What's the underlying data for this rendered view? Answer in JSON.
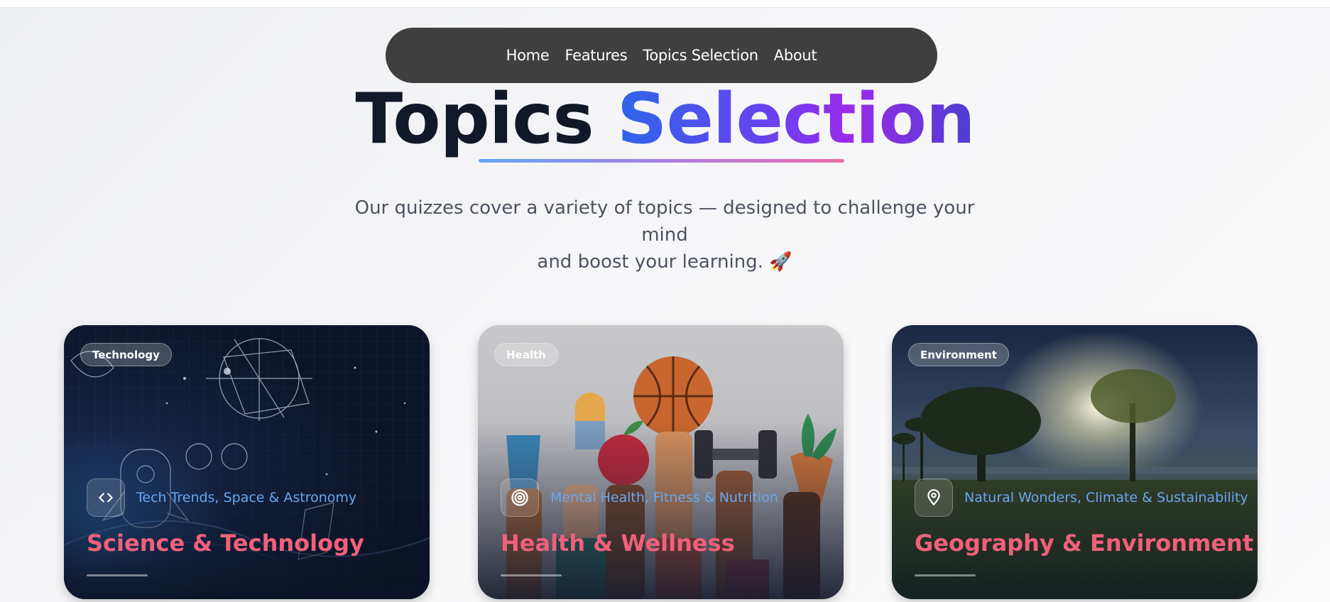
{
  "nav": {
    "items": [
      {
        "label": "Home"
      },
      {
        "label": "Features"
      },
      {
        "label": "Topics Selection"
      },
      {
        "label": "About"
      }
    ]
  },
  "hero": {
    "title_part1": "Topics",
    "title_part2": "Selection",
    "subtitle_line1": "Our quizzes cover a variety of topics — designed to challenge your mind",
    "subtitle_line2": "and boost your learning. 🚀"
  },
  "cards": [
    {
      "badge": "Technology",
      "tagline": "Tech Trends, Space & Astronomy",
      "title": "Science & Technology",
      "icon": "code-icon"
    },
    {
      "badge": "Health",
      "tagline": "Mental Health, Fitness & Nutrition",
      "title": "Health & Wellness",
      "icon": "target-icon"
    },
    {
      "badge": "Environment",
      "tagline": "Natural Wonders, Climate & Sustainability",
      "title": "Geography & Environment",
      "icon": "map-pin-icon"
    }
  ],
  "colors": {
    "nav_bg": "#3f3f3f",
    "title_dark": "#111827",
    "accent_blue": "#2f66e9",
    "accent_purple": "#9b2bea",
    "card_title": "#f0607a",
    "tagline": "#6aa7ef"
  }
}
